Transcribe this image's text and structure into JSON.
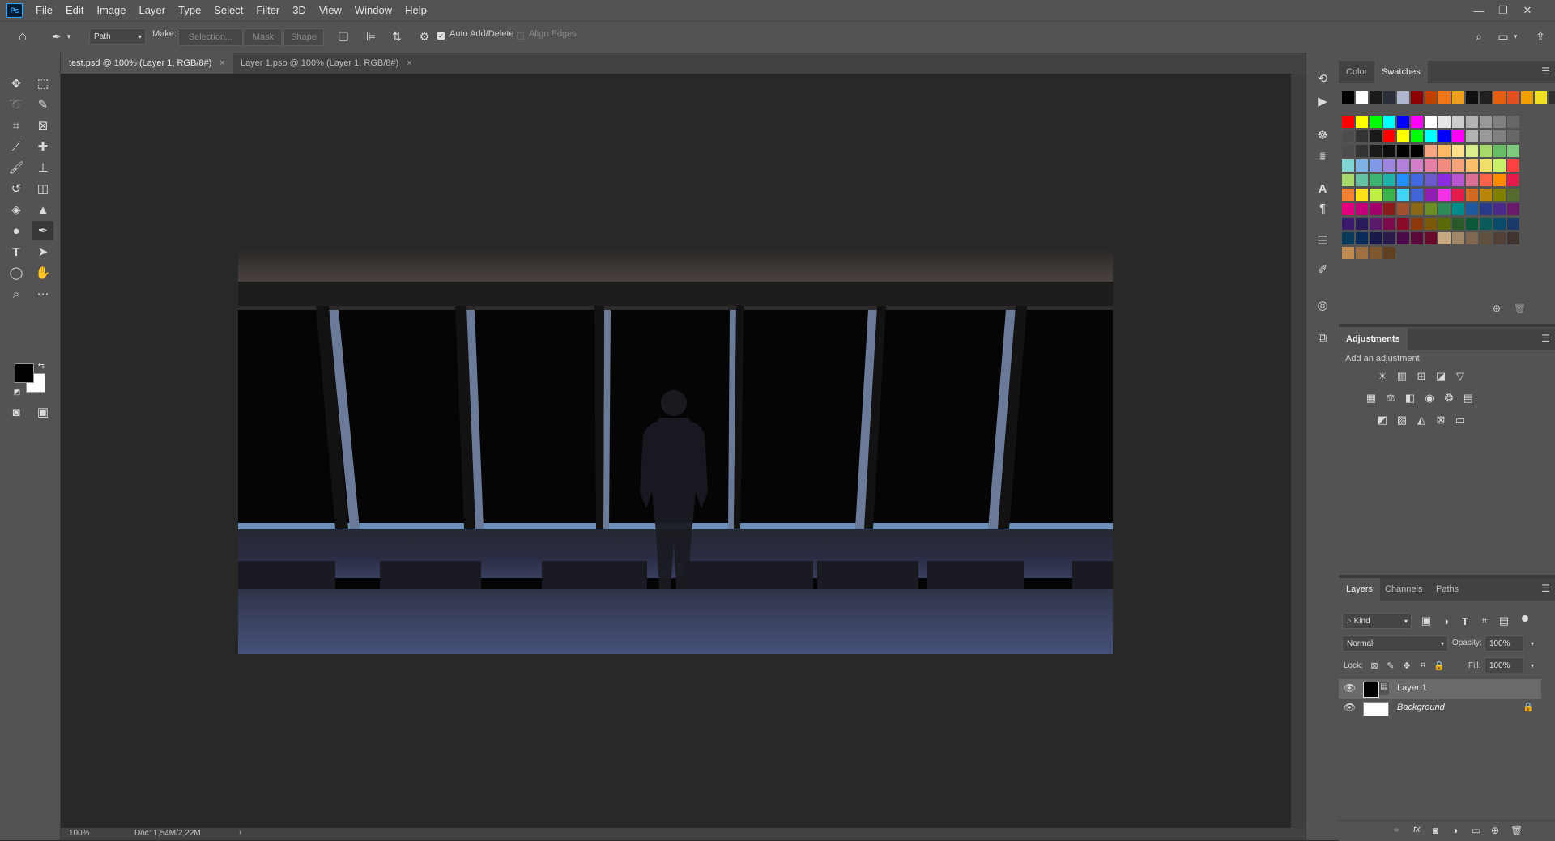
{
  "app": {
    "logo_text": "Ps"
  },
  "menu": [
    "File",
    "Edit",
    "Image",
    "Layer",
    "Type",
    "Select",
    "Filter",
    "3D",
    "View",
    "Window",
    "Help"
  ],
  "window_controls": {
    "minimize": "—",
    "restore": "❐",
    "close": "✕"
  },
  "options_bar": {
    "mode_value": "Path",
    "make_label": "Make:",
    "selection_btn": "Selection...",
    "mask_btn": "Mask",
    "shape_btn": "Shape",
    "auto_add_delete": "Auto Add/Delete",
    "align_edges": "Align Edges"
  },
  "tabs": [
    {
      "label": "test.psd @ 100% (Layer 1, RGB/8#)",
      "close": "×"
    },
    {
      "label": "Layer 1.psb @ 100% (Layer 1, RGB/8#)",
      "close": "×"
    }
  ],
  "status": {
    "zoom": "100%",
    "doc": "Doc: 1,54M/2,22M",
    "arrow": "›"
  },
  "swatches_panel": {
    "tabs": [
      "Color",
      "Swatches"
    ],
    "active_tab": "Swatches",
    "recent": [
      "#000000",
      "#ffffff",
      "#1a1a1a",
      "#2a2f3a",
      "#b0b8d0",
      "#8b0000",
      "#c04000",
      "#f07818",
      "#f0a020",
      "#101010",
      "#202020",
      "#e06010",
      "#e05020",
      "#f0a000",
      "#f0e020",
      "#303030"
    ],
    "grid": [
      [
        "#ff0000",
        "#ffff00",
        "#00ff00",
        "#00ffff",
        "#0000ff",
        "#ff00ff",
        "#ffffff",
        "#e6e6e6",
        "#cccccc",
        "#b3b3b3",
        "#999999",
        "#808080",
        "#666666"
      ],
      [
        "#4d4d4d",
        "#333333",
        "#1a1a1a",
        "#ff0000",
        "#ffff00",
        "#00ff00",
        "#00ffff",
        "#0000ff",
        "#ff00ff",
        "#b3b3b3",
        "#999999",
        "#808080",
        "#666666"
      ],
      [
        "#4d4d4d",
        "#333333",
        "#1a1a1a",
        "#0d0d0d",
        "#000000",
        "#000000",
        "#f4a582",
        "#fdb863",
        "#fee08b",
        "#d9ef8b",
        "#a6d96a",
        "#66bd63",
        "#7fc97f"
      ],
      [
        "#7fd4d4",
        "#7fb3e6",
        "#7f99e6",
        "#9c86e0",
        "#b27fd9",
        "#d27fc7",
        "#e67fa6",
        "#f08c7f",
        "#f5a37a",
        "#f9c06b",
        "#f0e06b",
        "#c8f06b",
        "#ff4040"
      ],
      [
        "#a6d96a",
        "#66c2a5",
        "#3cb371",
        "#20b2aa",
        "#1e90ff",
        "#4169e1",
        "#6a5acd",
        "#8a2be2",
        "#ba55d3",
        "#db7093",
        "#ff6347",
        "#ff8c00",
        "#e6194b"
      ],
      [
        "#f58231",
        "#ffe119",
        "#bfef45",
        "#3cb44b",
        "#42d4f4",
        "#4363d8",
        "#911eb4",
        "#f032e6",
        "#e6194b",
        "#d2691e",
        "#b8860b",
        "#808000",
        "#556b2f"
      ],
      [
        "#e00080",
        "#c0007a",
        "#a0006a",
        "#8b1a1a",
        "#a0522d",
        "#8b6914",
        "#6b8e23",
        "#2e8b57",
        "#008b8b",
        "#1e5aa0",
        "#2a3a8a",
        "#4b2a8a",
        "#6a1a6a"
      ],
      [
        "#3a1a6a",
        "#2a1a5a",
        "#5a1a6a",
        "#7a0a4a",
        "#8a0a2a",
        "#8a3a0a",
        "#7a5a0a",
        "#5a6a0a",
        "#2a5a2a",
        "#0a5a3a",
        "#0a5a5a",
        "#0a4a6a",
        "#1a3a6a"
      ],
      [
        "#0a3a5a",
        "#0a2a5a",
        "#1a1a4a",
        "#2a1a4a",
        "#4a0a4a",
        "#5a0a3a",
        "#6a0a2a",
        "#c8a882",
        "#a08868",
        "#806850",
        "#605040",
        "#504038",
        "#403430"
      ],
      [
        "#c08a50",
        "#a07040",
        "#805830",
        "#604020"
      ]
    ]
  },
  "adjustments_panel": {
    "title": "Adjustments",
    "subtitle": "Add an adjustment"
  },
  "layers_panel": {
    "tabs": [
      "Layers",
      "Channels",
      "Paths"
    ],
    "active_tab": "Layers",
    "kind_label": "Kind",
    "blend_mode": "Normal",
    "opacity_label": "Opacity:",
    "opacity_value": "100%",
    "lock_label": "Lock:",
    "fill_label": "Fill:",
    "fill_value": "100%",
    "layers": [
      {
        "name": "Layer 1",
        "selected": true
      },
      {
        "name": "Background",
        "selected": false,
        "locked": true
      }
    ]
  }
}
